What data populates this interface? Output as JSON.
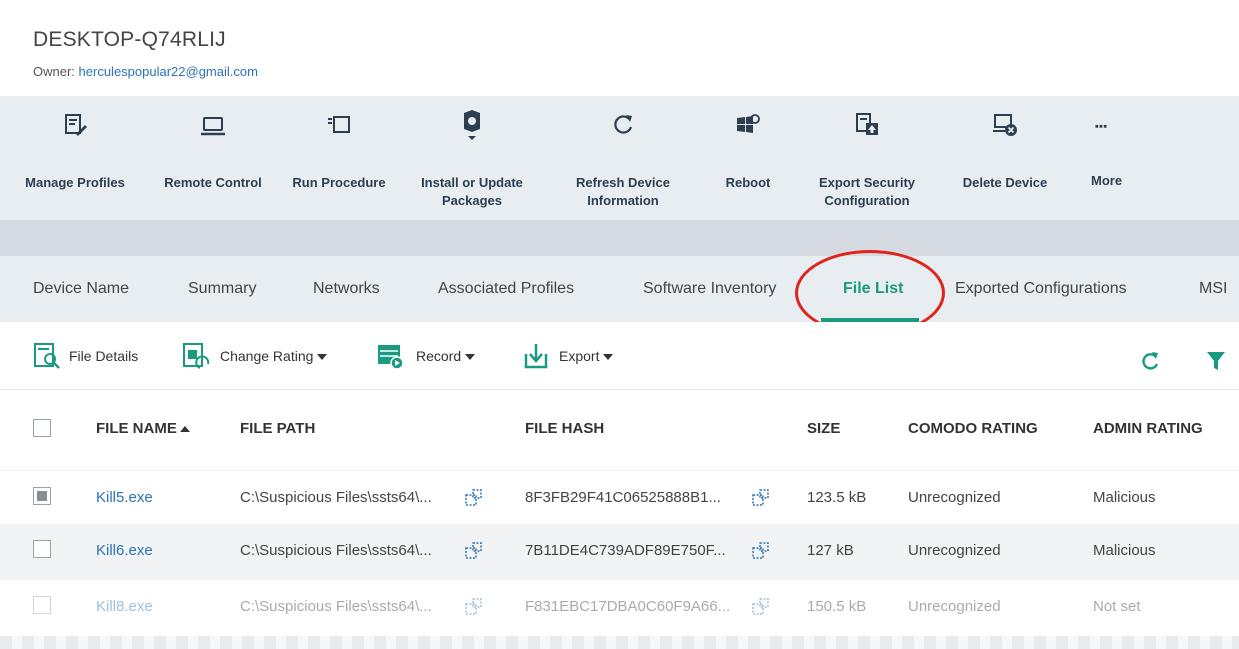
{
  "device": {
    "name": "DESKTOP-Q74RLIJ",
    "owner_label": "Owner:",
    "owner_email": "herculespopular22@gmail.com"
  },
  "toolbar": {
    "manage_profiles": "Manage Profiles",
    "remote_control": "Remote Control",
    "run_procedure": "Run Procedure",
    "install_line1": "Install or Update",
    "install_line2": "Packages",
    "refresh_line1": "Refresh Device",
    "refresh_line2": "Information",
    "reboot": "Reboot",
    "export_line1": "Export Security",
    "export_line2": "Configuration",
    "delete_device": "Delete Device",
    "more": "More"
  },
  "tabs": {
    "device_name": "Device Name",
    "summary": "Summary",
    "networks": "Networks",
    "associated_profiles": "Associated Profiles",
    "software_inventory": "Software Inventory",
    "file_list": "File List",
    "exported_configurations": "Exported Configurations",
    "msi": "MSI"
  },
  "actions": {
    "file_details": "File Details",
    "change_rating": "Change Rating",
    "record": "Record",
    "export": "Export"
  },
  "columns": {
    "file_name": "FILE NAME",
    "file_path": "FILE PATH",
    "file_hash": "FILE HASH",
    "size": "SIZE",
    "comodo_rating": "COMODO RATING",
    "admin_rating": "ADMIN RATING"
  },
  "rows": [
    {
      "name": "Kill5.exe",
      "path": "C:\\Suspicious Files\\ssts64\\...",
      "hash": "8F3FB29F41C06525888B1...",
      "size": "123.5 kB",
      "comodo": "Unrecognized",
      "admin": "Malicious",
      "checked": true
    },
    {
      "name": "Kill6.exe",
      "path": "C:\\Suspicious Files\\ssts64\\...",
      "hash": "7B11DE4C739ADF89E750F...",
      "size": "127 kB",
      "comodo": "Unrecognized",
      "admin": "Malicious",
      "checked": false
    },
    {
      "name": "Kill8.exe",
      "path": "C:\\Suspicious Files\\ssts64\\...",
      "hash": "F831EBC17DBA0C60F9A66...",
      "size": "150.5 kB",
      "comodo": "Unrecognized",
      "admin": "Not set",
      "checked": false
    }
  ],
  "colors": {
    "accent": "#1a9b7f",
    "link": "#2a73b8",
    "annotation": "#e0231c",
    "toolbar_bg": "#e8edf2"
  }
}
